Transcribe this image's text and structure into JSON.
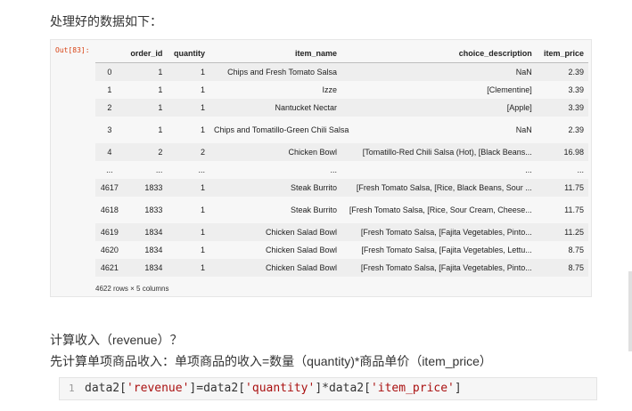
{
  "heading": "处理好的数据如下：",
  "out_prompt": "Out[83]:",
  "table": {
    "columns": [
      "order_id",
      "quantity",
      "item_name",
      "choice_description",
      "item_price"
    ],
    "rows": [
      {
        "index": "0",
        "cells": [
          "1",
          "1",
          "Chips and Fresh Tomato Salsa",
          "NaN",
          "2.39"
        ]
      },
      {
        "index": "1",
        "cells": [
          "1",
          "1",
          "Izze",
          "[Clementine]",
          "3.39"
        ]
      },
      {
        "index": "2",
        "cells": [
          "1",
          "1",
          "Nantucket Nectar",
          "[Apple]",
          "3.39"
        ]
      },
      {
        "index": "3",
        "cells": [
          "1",
          "1",
          "Chips and Tomatillo-Green Chili Salsa",
          "NaN",
          "2.39"
        ]
      },
      {
        "index": "4",
        "cells": [
          "2",
          "2",
          "Chicken Bowl",
          "[Tomatillo-Red Chili Salsa (Hot), [Black Beans...",
          "16.98"
        ]
      },
      {
        "index": "...",
        "cells": [
          "...",
          "...",
          "...",
          "...",
          "..."
        ]
      },
      {
        "index": "4617",
        "cells": [
          "1833",
          "1",
          "Steak Burrito",
          "[Fresh Tomato Salsa, [Rice, Black Beans, Sour ...",
          "11.75"
        ]
      },
      {
        "index": "4618",
        "cells": [
          "1833",
          "1",
          "Steak Burrito",
          "[Fresh Tomato Salsa, [Rice, Sour Cream, Cheese...",
          "11.75"
        ]
      },
      {
        "index": "4619",
        "cells": [
          "1834",
          "1",
          "Chicken Salad Bowl",
          "[Fresh Tomato Salsa, [Fajita Vegetables, Pinto...",
          "11.25"
        ]
      },
      {
        "index": "4620",
        "cells": [
          "1834",
          "1",
          "Chicken Salad Bowl",
          "[Fresh Tomato Salsa, [Fajita Vegetables, Lettu...",
          "8.75"
        ]
      },
      {
        "index": "4621",
        "cells": [
          "1834",
          "1",
          "Chicken Salad Bowl",
          "[Fresh Tomato Salsa, [Fajita Vegetables, Pinto...",
          "8.75"
        ]
      }
    ],
    "shape_note": "4622 rows × 5 columns"
  },
  "text1": "计算收入（revenue）？",
  "text2": "先计算单项商品收入：单项商品的收入=数量（quantity)*商品单价（item_price）",
  "code": {
    "line_number": "1",
    "parts": [
      "data2[",
      "'revenue'",
      "]=data2[",
      "'quantity'",
      "]*data2[",
      "'item_price'",
      "]"
    ]
  },
  "colors": {
    "prompt": "#d84315",
    "string": "#a11111"
  }
}
